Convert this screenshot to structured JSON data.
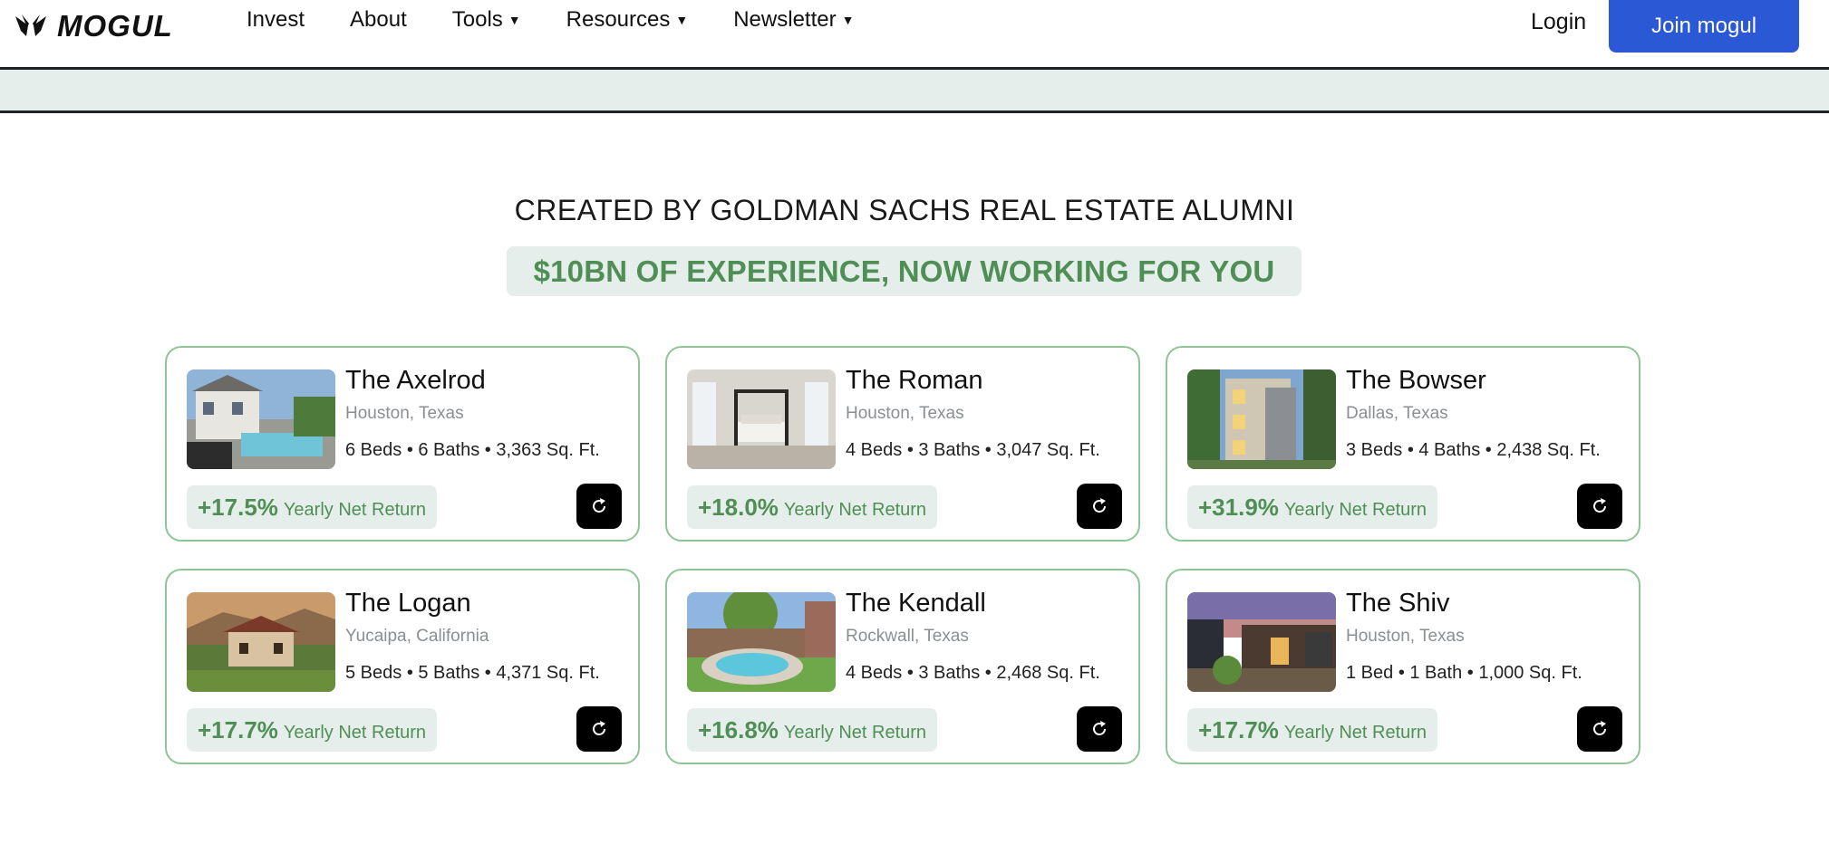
{
  "nav": {
    "brand": "MOGUL",
    "links": [
      {
        "label": "Invest"
      },
      {
        "label": "About"
      },
      {
        "label": "Tools"
      },
      {
        "label": "Resources"
      },
      {
        "label": "Newsletter"
      }
    ],
    "login": "Login",
    "join": "Join mogul"
  },
  "hero": {
    "headline": "CREATED BY GOLDMAN SACHS REAL ESTATE ALUMNI",
    "tagline": "$10BN OF EXPERIENCE, NOW WORKING FOR YOU"
  },
  "properties": [
    {
      "name": "The Axelrod",
      "location": "Houston, Texas",
      "specs": "6 Beds • 6 Baths • 3,363 Sq. Ft.",
      "return": "+17.5%",
      "return_label": "Yearly Net Return"
    },
    {
      "name": "The Roman",
      "location": "Houston, Texas",
      "specs": "4 Beds • 3 Baths • 3,047 Sq. Ft.",
      "return": "+18.0%",
      "return_label": "Yearly Net Return"
    },
    {
      "name": "The Bowser",
      "location": "Dallas, Texas",
      "specs": "3 Beds • 4 Baths • 2,438 Sq. Ft.",
      "return": "+31.9%",
      "return_label": "Yearly Net Return"
    },
    {
      "name": "The Logan",
      "location": "Yucaipa, California",
      "specs": "5 Beds • 5 Baths • 4,371 Sq. Ft.",
      "return": "+17.7%",
      "return_label": "Yearly Net Return"
    },
    {
      "name": "The Kendall",
      "location": "Rockwall, Texas",
      "specs": "4 Beds • 3 Baths • 2,468 Sq. Ft.",
      "return": "+16.8%",
      "return_label": "Yearly Net Return"
    },
    {
      "name": "The Shiv",
      "location": "Houston, Texas",
      "specs": "1 Bed • 1 Bath • 1,000 Sq. Ft.",
      "return": "+17.7%",
      "return_label": "Yearly Net Return"
    }
  ],
  "colors": {
    "accent": "#2b59d6",
    "return_green": "#4f8f55",
    "card_border": "#8fc596",
    "tint": "#e6eeeb"
  }
}
